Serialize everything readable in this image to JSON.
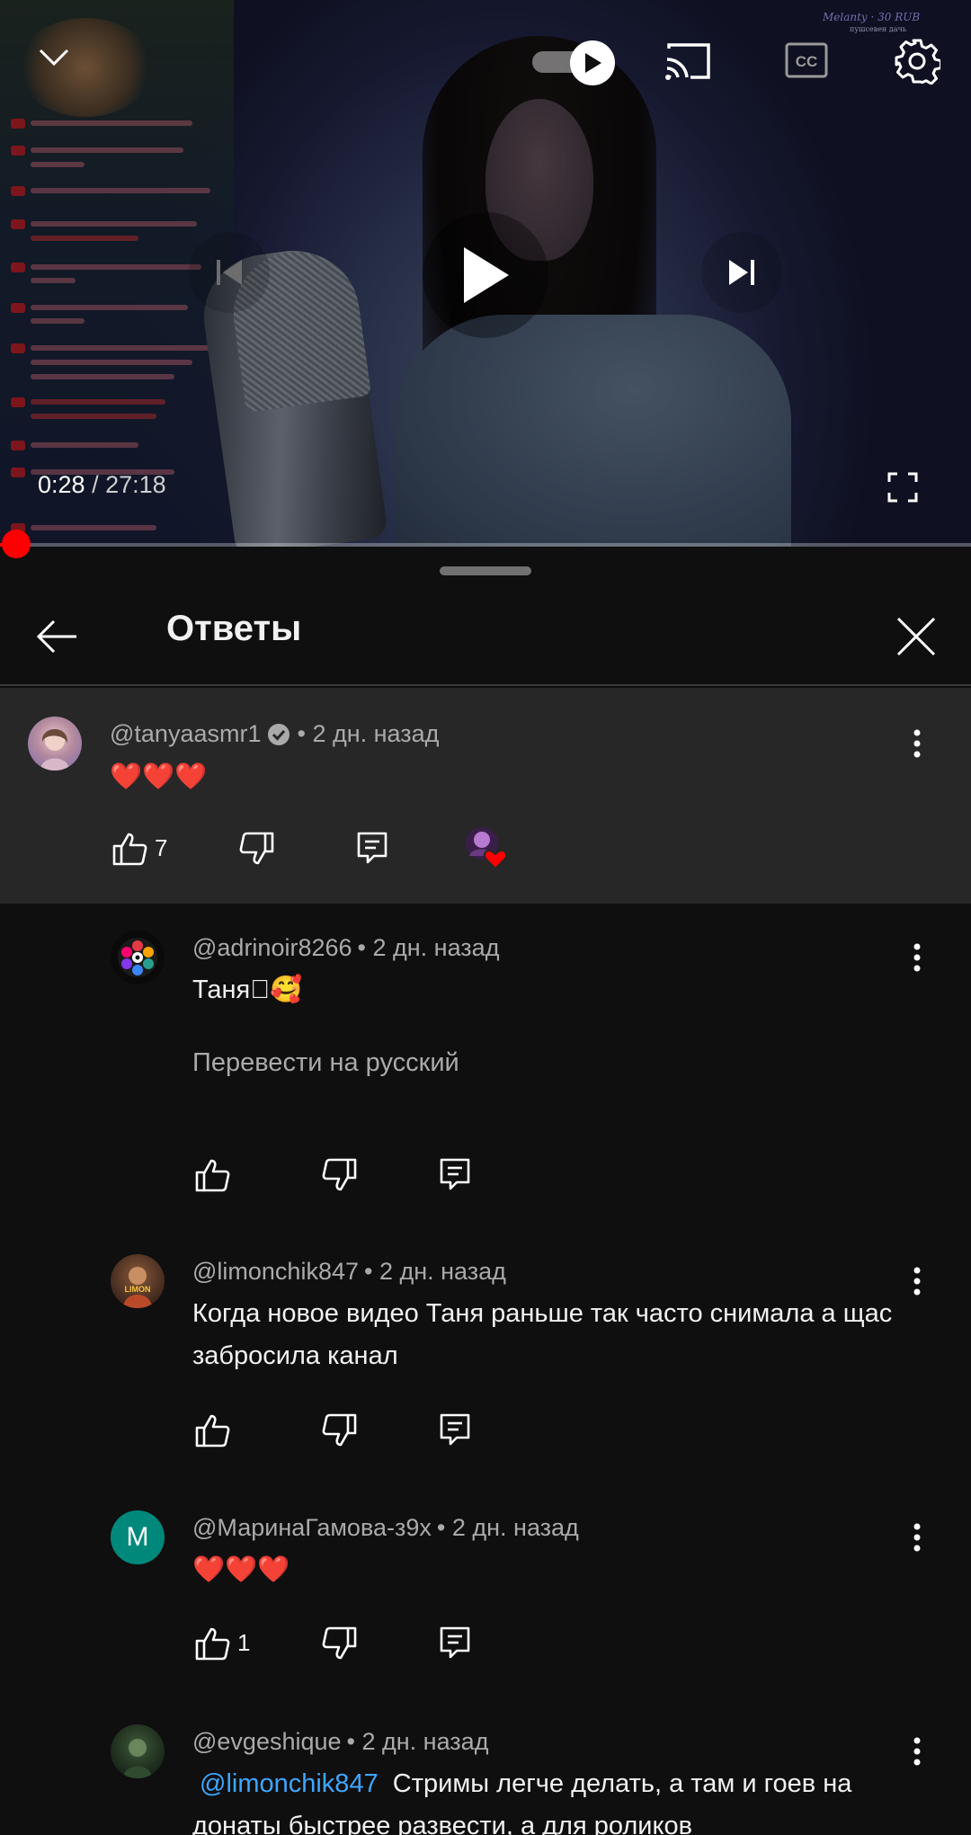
{
  "player": {
    "watermark": "Melanty · 30 RUB",
    "watermark_sub": "пушсевен дачь",
    "time_current": "0:28",
    "time_separator": " / ",
    "time_total": "27:18",
    "progress_fraction": 0.017,
    "autoplay_on": true
  },
  "panel": {
    "title": "Ответы"
  },
  "parent_comment": {
    "author": "@tanyaasmr1",
    "verified": true,
    "time": "• 2 дн. назад",
    "text": "❤️❤️❤️",
    "likes": "7"
  },
  "replies": [
    {
      "author": "@adrinoir8266",
      "time": "• 2 дн. назад",
      "text": "Таня\u0000🥰",
      "translate": "Перевести на русский",
      "likes": ""
    },
    {
      "author": "@limonchik847",
      "time": "• 2 дн. назад",
      "text": "Когда новое видео Таня раньше так часто снимала а щас забросила канал",
      "likes": ""
    },
    {
      "author": "@МаринаГамова-з9х",
      "avatar_letter": "M",
      "time": "• 2 дн. назад",
      "text": "❤️❤️❤️",
      "likes": "1"
    },
    {
      "author": "@evgeshique",
      "time": "• 2 дн. назад",
      "mention": "@limonchik847",
      "text": "Стримы легче делать, а там и гоев на донаты быстрее развести, а для роликов"
    }
  ],
  "colors": {
    "background": "#0f0f0f",
    "parent_background": "#272727",
    "accent_red": "#ff0000",
    "mention_blue": "#3ea6ff",
    "muted_text": "#aaaaaa"
  }
}
